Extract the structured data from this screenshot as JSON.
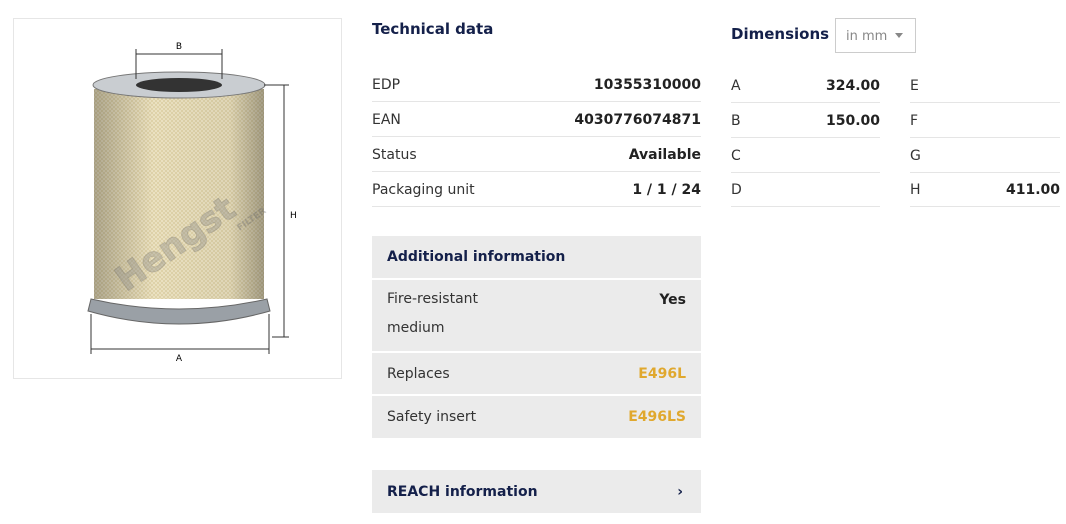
{
  "image": {
    "labels": {
      "a": "A",
      "b": "B",
      "h": "H"
    },
    "watermark": "Hengst",
    "watermark_sub": "FILTER"
  },
  "technical": {
    "title": "Technical data",
    "rows": [
      {
        "label": "EDP",
        "value": "10355310000"
      },
      {
        "label": "EAN",
        "value": "4030776074871"
      },
      {
        "label": "Status",
        "value": "Available"
      },
      {
        "label": "Packaging unit",
        "value": "1 / 1 / 24"
      }
    ]
  },
  "dimensions": {
    "title": "Dimensions",
    "unit": "in mm",
    "left": [
      {
        "label": "A",
        "value": "324.00"
      },
      {
        "label": "B",
        "value": "150.00"
      },
      {
        "label": "C",
        "value": ""
      },
      {
        "label": "D",
        "value": ""
      }
    ],
    "right": [
      {
        "label": "E",
        "value": ""
      },
      {
        "label": "F",
        "value": ""
      },
      {
        "label": "G",
        "value": ""
      },
      {
        "label": "H",
        "value": "411.00"
      }
    ]
  },
  "additional": {
    "title": "Additional information",
    "rows": [
      {
        "label": "Fire-resistant medium",
        "value": "Yes"
      },
      {
        "label": "Replaces",
        "value": "E496L"
      },
      {
        "label": "Safety insert",
        "value": "E496LS"
      }
    ]
  },
  "reach": {
    "label": "REACH information",
    "chevron": "chevron-right-icon"
  },
  "colors": {
    "title": "#14204a",
    "link": "#e0a82e",
    "panel": "#ebebeb"
  }
}
